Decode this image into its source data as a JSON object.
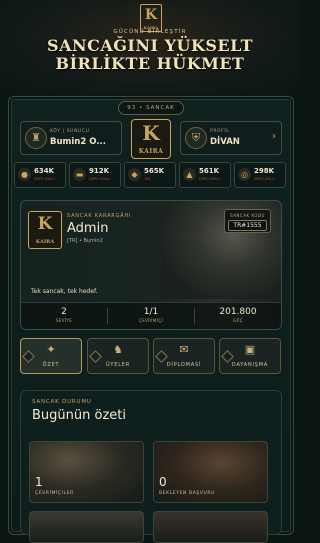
{
  "header": {
    "tagline": "GÜCÜNÜ BİRLEŞTİR",
    "title_line1": "SANCAĞINI YÜKSELT",
    "title_line2": "BİRLİKTE HÜKMET",
    "logo_letter": "K",
    "logo_name": "KAIRA"
  },
  "top_badge": "93 • SANCAK",
  "left_box": {
    "label": "KÖY | SUNUCU",
    "value": "Bumin2 O...",
    "icon": "castle-icon"
  },
  "right_box": {
    "label": "PROFİL",
    "value": "DİVAN",
    "icon": "shield-icon",
    "arrow": "›"
  },
  "emblem": {
    "letter": "K",
    "name": "KAIRA"
  },
  "resources": [
    {
      "value": "634K",
      "label": "DEPO DOLU",
      "icon": "bread-icon"
    },
    {
      "value": "912K",
      "label": "DEPO DOLU",
      "icon": "wood-icon"
    },
    {
      "value": "565K",
      "label": "TAŞ",
      "icon": "stone-icon"
    },
    {
      "value": "561K",
      "label": "DEPO DOLU",
      "icon": "iron-icon"
    },
    {
      "value": "298K",
      "label": "DEPO DOLU",
      "icon": "gold-icon"
    }
  ],
  "card": {
    "label": "SANCAK KARARGÂHI",
    "name": "Admin",
    "sub": "[TR] • Bumin2",
    "code_label": "SANCAK KODU",
    "code": "TR#1555",
    "motto": "Tek sancak, tek hedef.",
    "logo_letter": "K",
    "logo_name": "KAIRA",
    "stats": [
      {
        "value": "2",
        "label": "SEVİYE"
      },
      {
        "value": "1/1",
        "label": "ÇEVRİMİÇİ"
      },
      {
        "value": "201.800",
        "label": "GÜÇ"
      }
    ]
  },
  "tabs": [
    {
      "label": "ÖZET",
      "icon": "compass-icon"
    },
    {
      "label": "ÜYELER",
      "icon": "soldiers-icon"
    },
    {
      "label": "DİPLOMASİ",
      "icon": "scroll-icon"
    },
    {
      "label": "DAYANIŞMA",
      "icon": "supplies-icon"
    }
  ],
  "status": {
    "label": "SANCAK DURUMU",
    "title": "Bugünün özeti",
    "items": [
      {
        "value": "1",
        "label": "ÇEVRİMİÇİLER"
      },
      {
        "value": "0",
        "label": "BEKLEYEN BAŞVURU"
      }
    ]
  },
  "colors": {
    "accent_gold": "#c9a45a",
    "background": "#0a1514",
    "resource_label": "#b84b3a"
  }
}
